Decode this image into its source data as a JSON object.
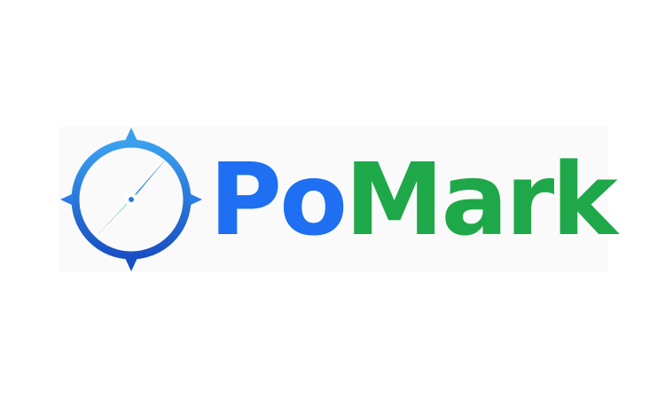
{
  "logo": {
    "brand_name_part1": "Po",
    "brand_name_part2": "Mark",
    "icon": "compass-icon",
    "colors": {
      "blue": "#1e6ff2",
      "dark_blue": "#1a4fc4",
      "light_blue": "#3aa0ee",
      "green": "#1fa84a",
      "background": "#ffffff"
    }
  }
}
